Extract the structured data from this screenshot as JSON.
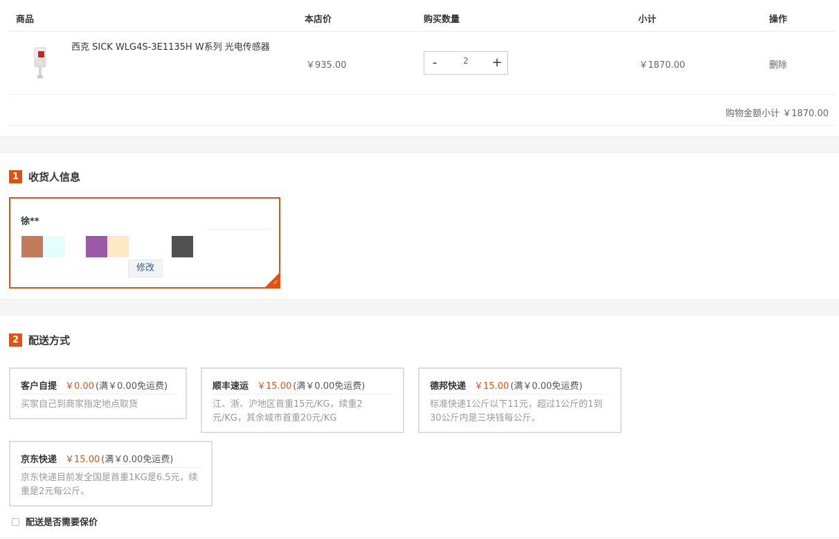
{
  "cart": {
    "headers": {
      "product": "商品",
      "price": "本店价",
      "quantity": "购买数量",
      "subtotal": "小计",
      "operation": "操作"
    },
    "item": {
      "name": "西克 SICK WLG4S-3E1135H W系列 光电传感器",
      "price": "￥935.00",
      "quantity": "2",
      "minus": "-",
      "plus": "+",
      "subtotal": "￥1870.00",
      "delete": "删除"
    },
    "total_text": "购物金额小计 ￥1870.00"
  },
  "receiver": {
    "step": "1",
    "title": "收货人信息",
    "name": "徐**",
    "edit": "修改"
  },
  "delivery": {
    "step": "2",
    "title": "配送方式",
    "options": [
      {
        "name": "客户自提",
        "fee": "￥0.00",
        "free": "(满￥0.00免运费)",
        "desc": "买家自己到商家指定地点取货"
      },
      {
        "name": "顺丰速运",
        "fee": "￥15.00",
        "free": "(满￥0.00免运费)",
        "desc": "江、浙、沪地区首重15元/KG，续重2元/KG，其余城市首重20元/KG"
      },
      {
        "name": "德邦快递",
        "fee": "￥15.00",
        "free": "(满￥0.00免运费)",
        "desc": "标准快递1公斤以下11元，超过1公斤的1到30公斤内是三块钱每公斤。"
      },
      {
        "name": "京东快递",
        "fee": "￥15.00",
        "free": "(满￥0.00免运费)",
        "desc": "京东快递目前发全国是首重1KG是6.5元，续重是2元每公斤。"
      }
    ],
    "insure_label": "配送是否需要保价"
  },
  "colors": {
    "accent": "#e4500f"
  }
}
